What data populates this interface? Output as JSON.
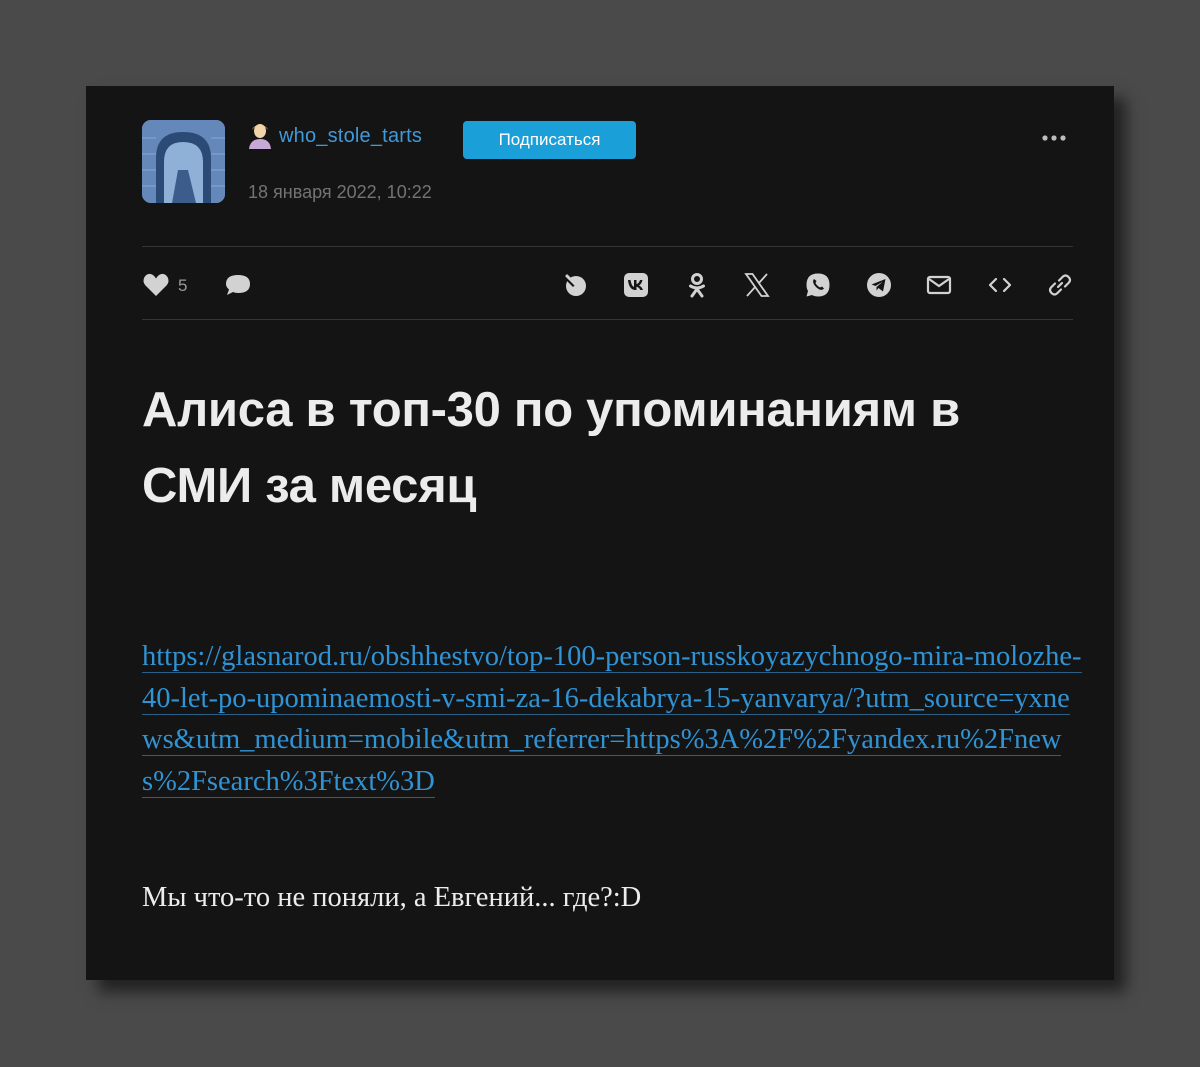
{
  "author": {
    "username": "who_stole_tarts",
    "date": "18 января 2022, 10:22"
  },
  "subscribe_label": "Подписаться",
  "likes_count": "5",
  "icons": {
    "user": "user-badge-icon",
    "more": "more-dots-icon",
    "like": "heart-icon",
    "comment": "comment-bubble-icon",
    "share": [
      "pin-icon",
      "vk-icon",
      "ok-icon",
      "x-icon",
      "whatsapp-icon",
      "telegram-icon",
      "mail-icon",
      "embed-code-icon",
      "copy-link-icon"
    ]
  },
  "post": {
    "title": "Алиса в топ-30 по упоминаниям в СМИ за месяц",
    "link": "https://glasnarod.ru/obshhestvo/top-100-person-russkoyazychnogo-mira-molozhe-40-let-po-upominaemosti-v-smi-za-16-dekabrya-15-yanvarya/?utm_source=yxnews&utm_medium=mobile&utm_referrer=https%3A%2F%2Fyandex.ru%2Fnews%2Fsearch%3Ftext%3D",
    "text": "Мы что-то не поняли, а Евгений... где?:D"
  },
  "colors": {
    "background": "#4a4a4a",
    "card": "#141415",
    "accent": "#1b9fd8",
    "link": "#3093d4",
    "text": "#ececec",
    "muted": "#737373"
  }
}
